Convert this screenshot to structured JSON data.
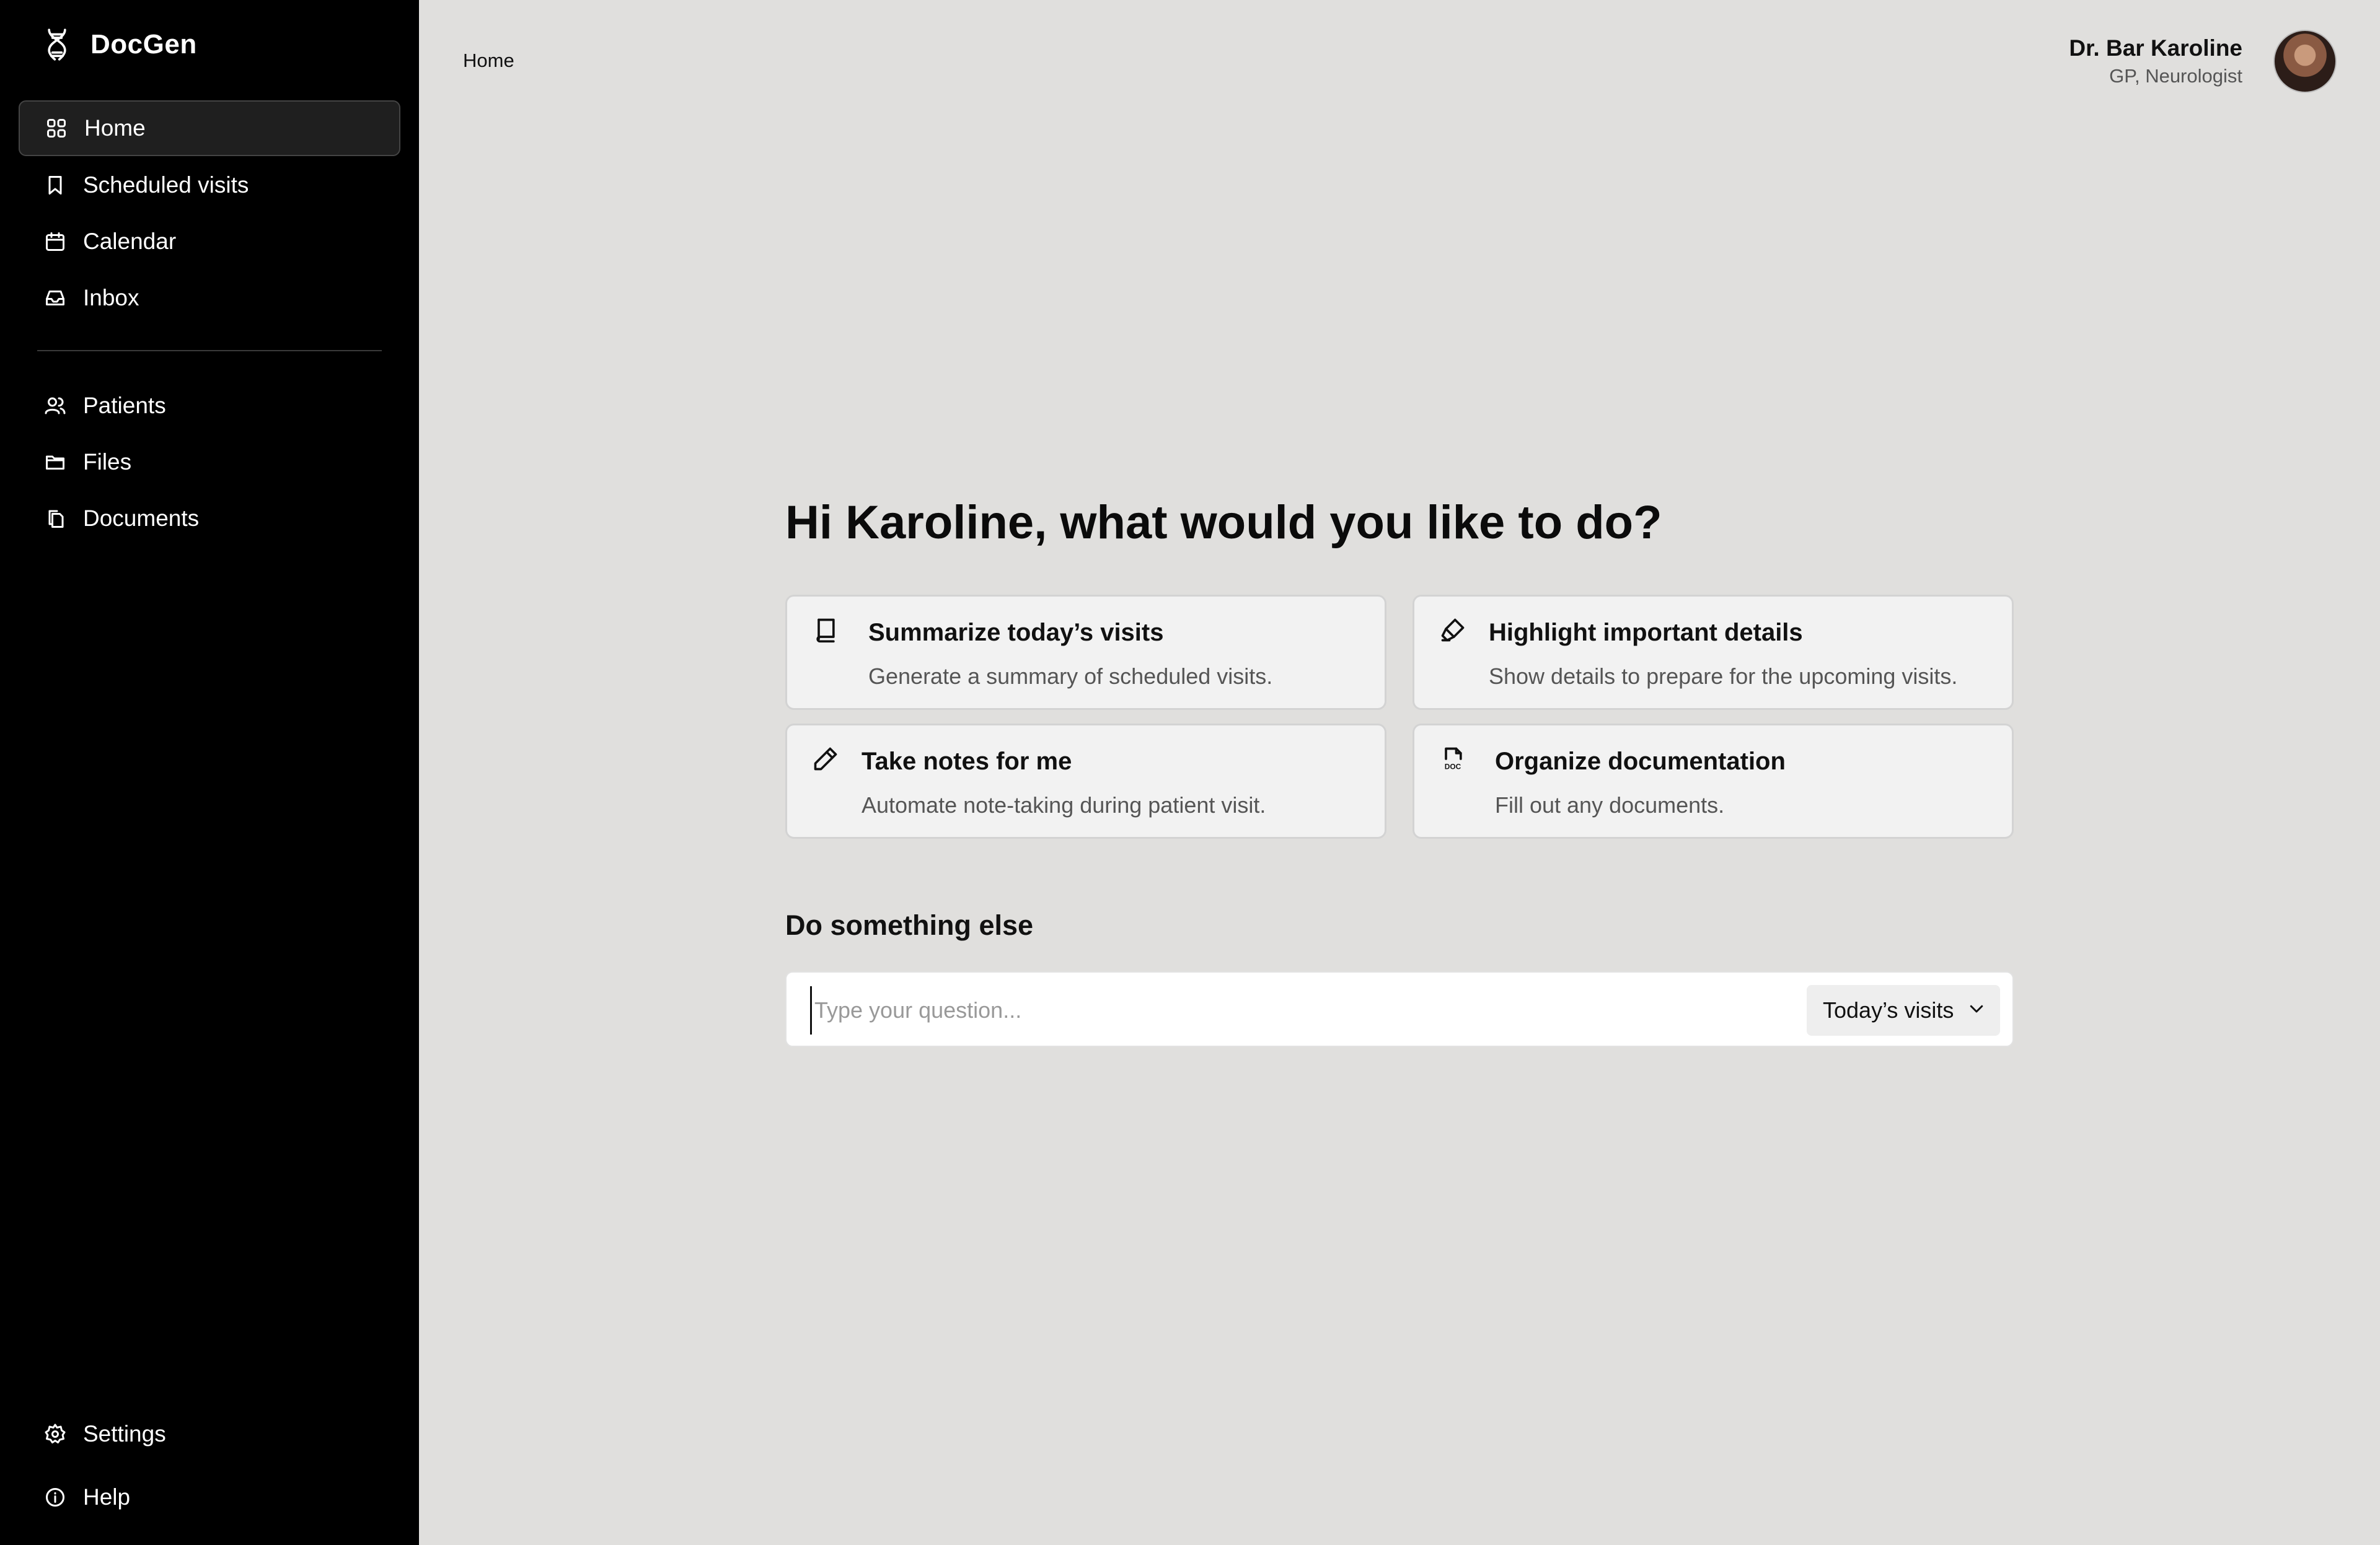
{
  "app": {
    "name": "DocGen"
  },
  "sidebar": {
    "primary": [
      {
        "label": "Home",
        "icon": "grid-icon",
        "active": true
      },
      {
        "label": "Scheduled visits",
        "icon": "bookmark-icon"
      },
      {
        "label": "Calendar",
        "icon": "calendar-icon"
      },
      {
        "label": "Inbox",
        "icon": "inbox-icon"
      }
    ],
    "secondary": [
      {
        "label": "Patients",
        "icon": "users-icon"
      },
      {
        "label": "Files",
        "icon": "folder-icon"
      },
      {
        "label": "Documents",
        "icon": "documents-icon"
      }
    ],
    "footer": [
      {
        "label": "Settings",
        "icon": "gear-icon"
      },
      {
        "label": "Help",
        "icon": "info-icon"
      }
    ]
  },
  "breadcrumb": "Home",
  "user": {
    "name": "Dr. Bar Karoline",
    "role": "GP, Neurologist"
  },
  "main": {
    "greeting": "Hi Karoline, what would you like to do?",
    "cards": [
      {
        "title": "Summarize today’s visits",
        "subtitle": "Generate a summary of scheduled visits.",
        "icon": "book-icon"
      },
      {
        "title": "Highlight important details",
        "subtitle": "Show details to prepare for the upcoming visits.",
        "icon": "highlighter-icon"
      },
      {
        "title": "Take notes for me",
        "subtitle": "Automate note-taking during patient visit.",
        "icon": "pencil-icon"
      },
      {
        "title": "Organize documentation",
        "subtitle": "Fill out any documents.",
        "icon": "doc-file-icon"
      }
    ],
    "other_title": "Do something else",
    "ask": {
      "placeholder": "Type your question...",
      "value": "",
      "scope": "Today’s visits"
    }
  }
}
